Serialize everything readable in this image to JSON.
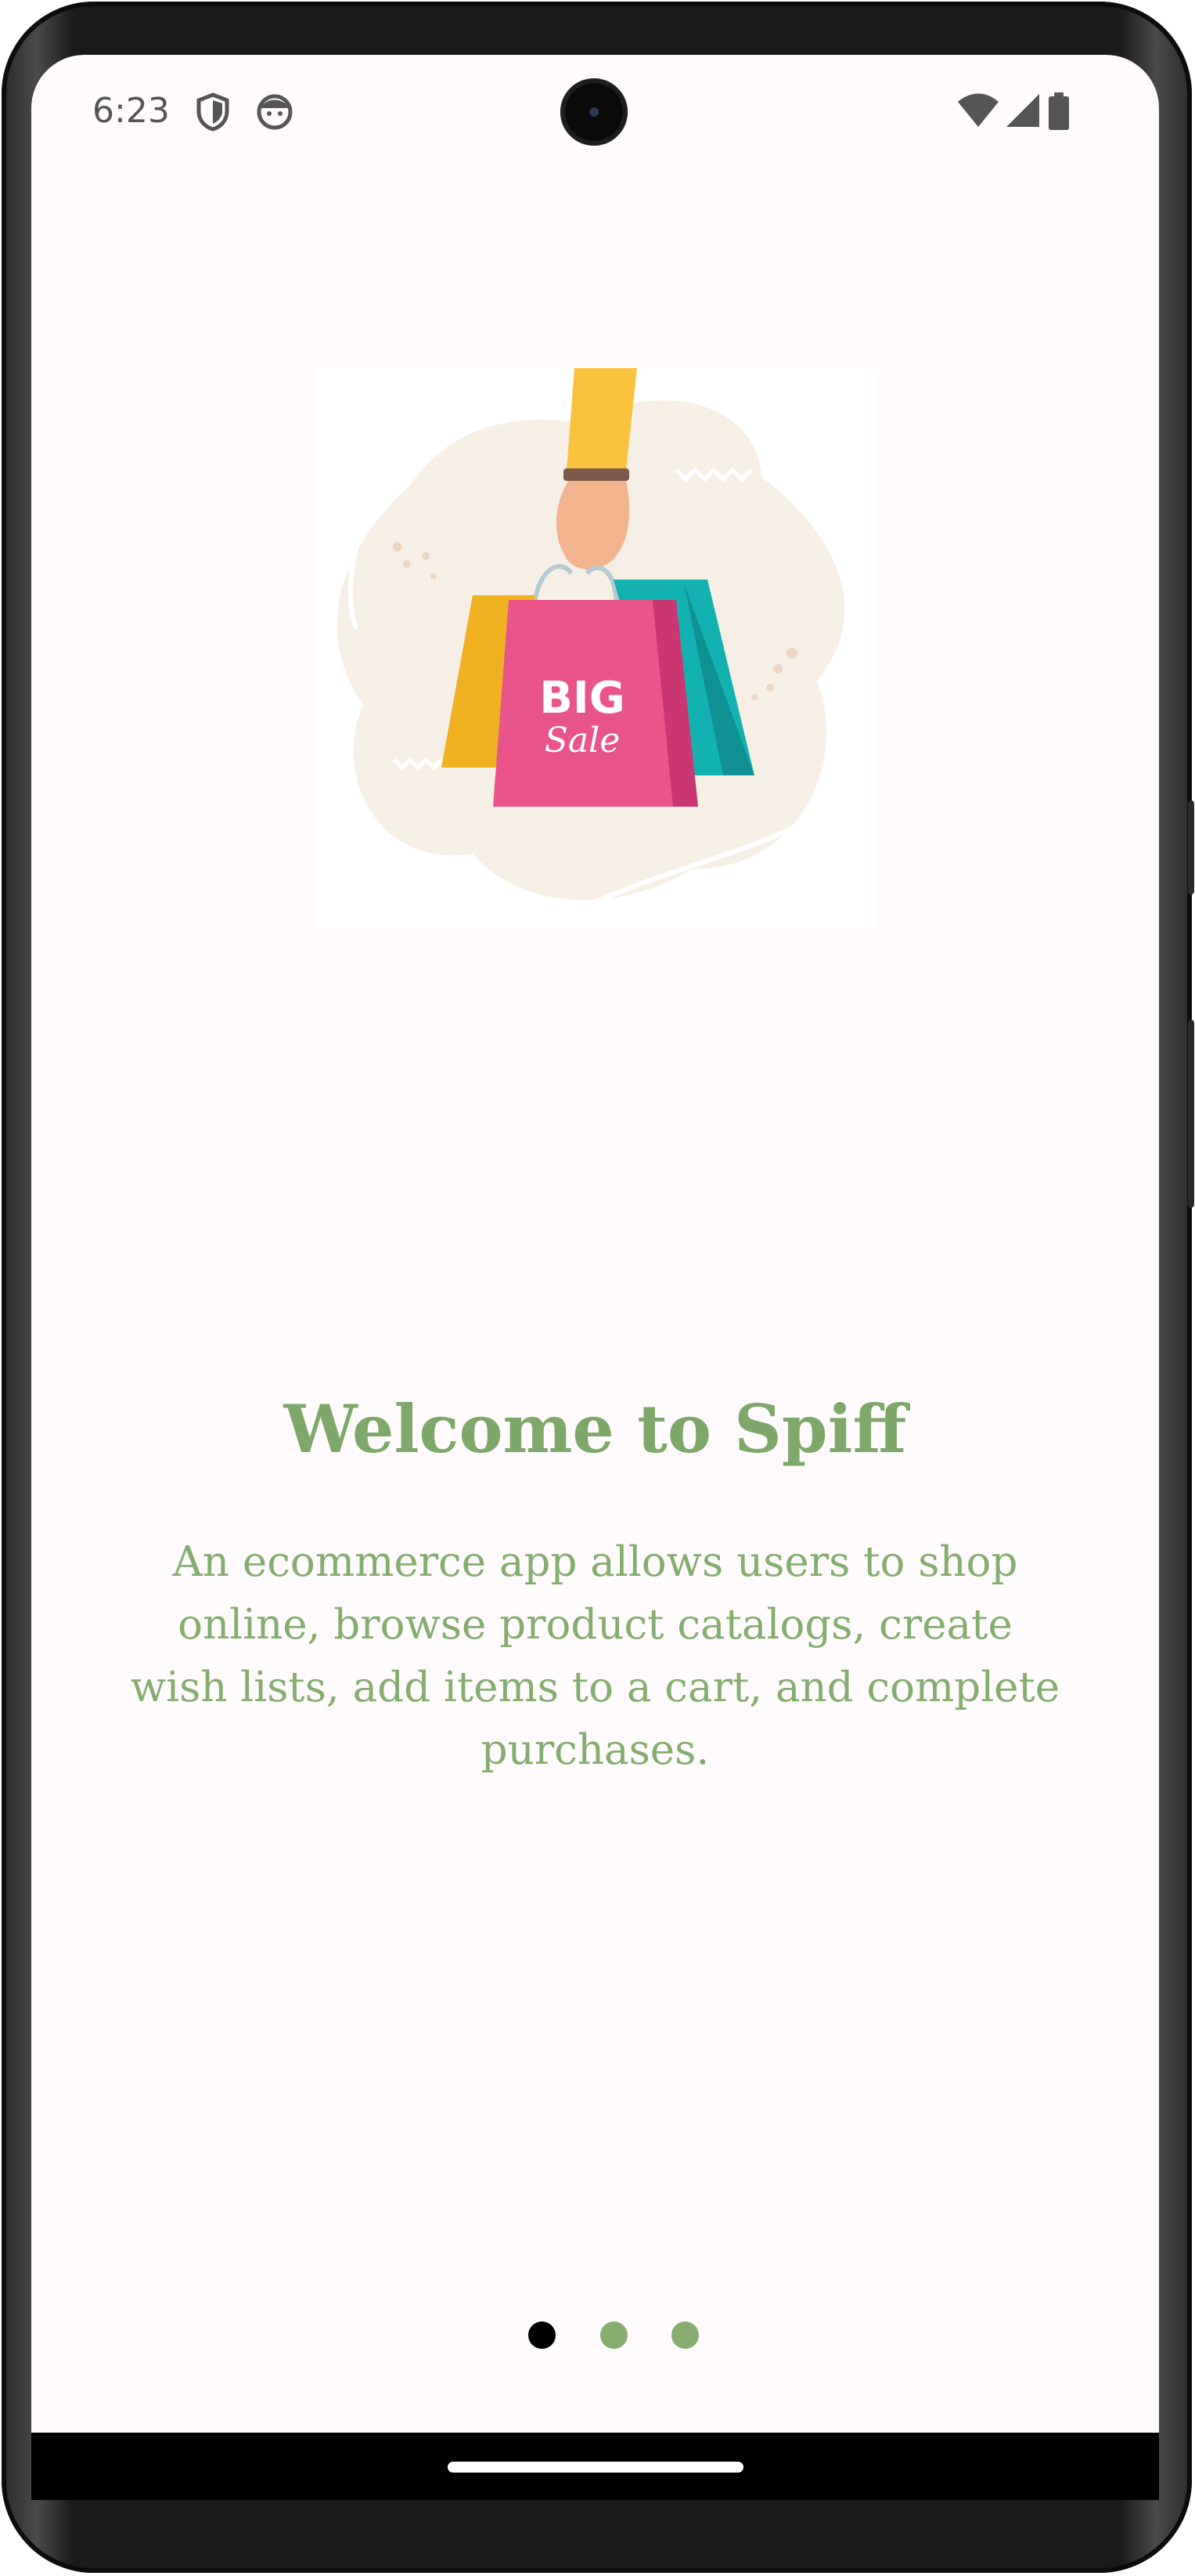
{
  "status_bar": {
    "time": "6:23",
    "left_icons": [
      "shield-icon",
      "face-icon"
    ],
    "right_icons": [
      "wifi-icon",
      "signal-icon",
      "battery-icon"
    ]
  },
  "onboarding": {
    "illustration": "shopping-bags-big-sale-illustration",
    "illustration_text_1": "BIG",
    "illustration_text_2": "Sale",
    "title": "Welcome to Spiff",
    "description": "An ecommerce app allows users to shop online, browse product catalogs, create wish lists, add items to a cart, and complete purchases."
  },
  "pager": {
    "total_pages": 3,
    "current_page": 1
  },
  "colors": {
    "accent_green": "#7ea86a",
    "dot_active": "#000000",
    "dot_inactive": "#86ad6f",
    "background": "#fffbfd"
  }
}
